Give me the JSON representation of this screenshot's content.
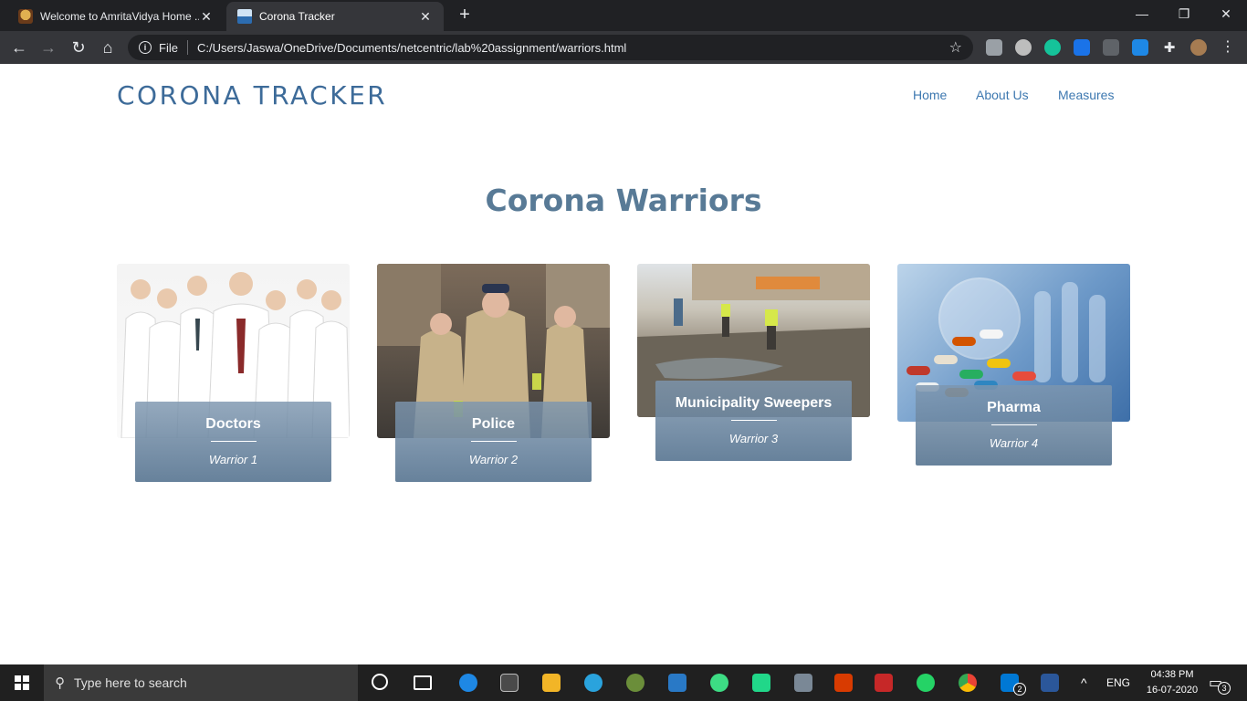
{
  "browser": {
    "tabs": [
      {
        "title": "Welcome to AmritaVidya Home ...",
        "active": false
      },
      {
        "title": "Corona Tracker",
        "active": true
      }
    ],
    "address": {
      "scheme_label": "File",
      "url": "C:/Users/Jaswa/OneDrive/Documents/netcentric/lab%20assignment/warriors.html"
    }
  },
  "site": {
    "brand": "CORONA TRACKER",
    "nav": [
      {
        "label": "Home"
      },
      {
        "label": "About Us"
      },
      {
        "label": "Measures"
      }
    ],
    "heading": "Corona Warriors",
    "cards": [
      {
        "title": "Doctors",
        "subtitle": "Warrior 1",
        "image": "doctors-photo"
      },
      {
        "title": "Police",
        "subtitle": "Warrior 2",
        "image": "police-photo"
      },
      {
        "title": "Municipality Sweepers",
        "subtitle": "Warrior 3",
        "image": "sweepers-photo"
      },
      {
        "title": "Pharma",
        "subtitle": "Warrior 4",
        "image": "pharma-photo"
      }
    ]
  },
  "taskbar": {
    "search_placeholder": "Type here to search",
    "language": "ENG",
    "time": "04:38 PM",
    "date": "16-07-2020",
    "mail_badge": "2",
    "notification_badge": "3"
  },
  "colors": {
    "brand": "#3d6b99",
    "heading": "#587a96",
    "caption_bg": "#6f8ba6",
    "nav_link": "#3d78b0"
  }
}
